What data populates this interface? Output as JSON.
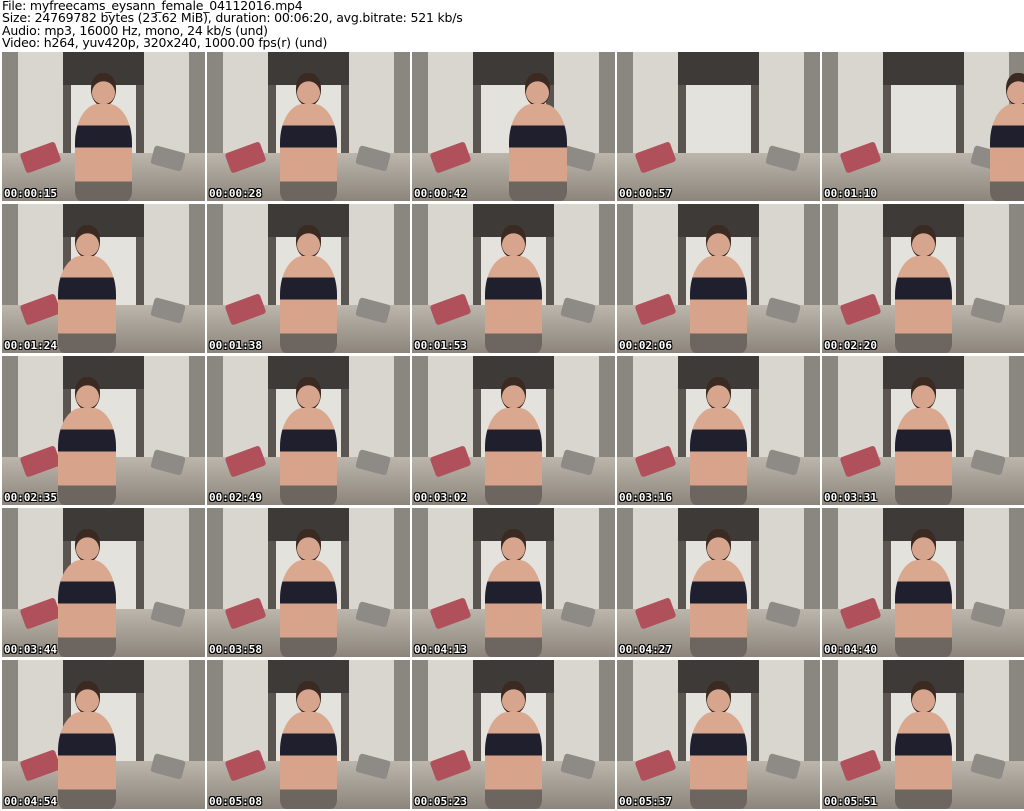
{
  "info": {
    "file": "File: myfreecams_eysann_female_04112016.mp4",
    "size": "Size: 24769782 bytes (23.62 MiB), duration: 00:06:20, avg.bitrate: 521 kb/s",
    "audio": "Audio: mp3, 16000 Hz, mono, 24 kb/s (und)",
    "video": "Video: h264, yuv420p, 320x240, 1000.00 fps(r) (und)"
  },
  "thumbnails": [
    {
      "timestamp": "00:00:15",
      "figure": "center"
    },
    {
      "timestamp": "00:00:28",
      "figure": "center"
    },
    {
      "timestamp": "00:00:42",
      "figure": "center-right"
    },
    {
      "timestamp": "00:00:57",
      "figure": "none"
    },
    {
      "timestamp": "00:01:10",
      "figure": "right"
    },
    {
      "timestamp": "00:01:24",
      "figure": "center-left"
    },
    {
      "timestamp": "00:01:38",
      "figure": "center"
    },
    {
      "timestamp": "00:01:53",
      "figure": "center"
    },
    {
      "timestamp": "00:02:06",
      "figure": "center"
    },
    {
      "timestamp": "00:02:20",
      "figure": "center"
    },
    {
      "timestamp": "00:02:35",
      "figure": "center-left"
    },
    {
      "timestamp": "00:02:49",
      "figure": "center"
    },
    {
      "timestamp": "00:03:02",
      "figure": "center"
    },
    {
      "timestamp": "00:03:16",
      "figure": "center"
    },
    {
      "timestamp": "00:03:31",
      "figure": "center"
    },
    {
      "timestamp": "00:03:44",
      "figure": "center-left"
    },
    {
      "timestamp": "00:03:58",
      "figure": "center"
    },
    {
      "timestamp": "00:04:13",
      "figure": "center"
    },
    {
      "timestamp": "00:04:27",
      "figure": "center"
    },
    {
      "timestamp": "00:04:40",
      "figure": "center"
    },
    {
      "timestamp": "00:04:54",
      "figure": "center-left"
    },
    {
      "timestamp": "00:05:08",
      "figure": "center"
    },
    {
      "timestamp": "00:05:23",
      "figure": "center"
    },
    {
      "timestamp": "00:05:37",
      "figure": "center"
    },
    {
      "timestamp": "00:05:51",
      "figure": "center"
    }
  ]
}
